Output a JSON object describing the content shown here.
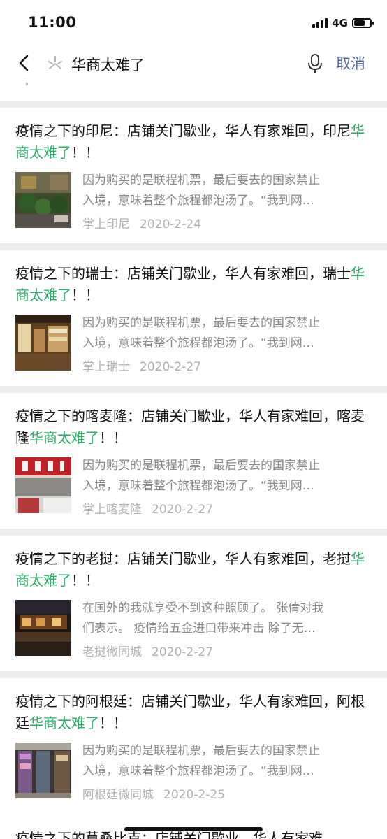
{
  "status": {
    "time": "11:00",
    "network": "4G",
    "battery_level": 0.7
  },
  "search": {
    "query": "华商太难了",
    "cancel_label": "取消"
  },
  "results": [
    {
      "title_pre": "疫情之下的印尼：店铺关门歇业，华人有家难回，印尼",
      "title_hl": "华商太难了",
      "title_post": "！！",
      "snippet_line1": "因为购买的是联程机票，最后要去的国家禁止",
      "snippet_line2": "入境，意味着整个旅程都泡汤了。“我到网…",
      "source": "掌上印尼",
      "date": "2020-2-24",
      "thumb": "street-scene"
    },
    {
      "title_pre": "疫情之下的瑞士：店铺关门歇业，华人有家难回，瑞士",
      "title_hl": "华商太难了",
      "title_post": "！！",
      "snippet_line1": "因为购买的是联程机票，最后要去的国家禁止",
      "snippet_line2": "入境，意味着整个旅程都泡汤了。“我到网…",
      "source": "掌上瑞士",
      "date": "2020-2-27",
      "thumb": "shop-interior"
    },
    {
      "title_pre": "疫情之下的喀麦隆：店铺关门歇业，华人有家难回，喀麦隆",
      "title_hl": "华商太难了",
      "title_post": "！！",
      "snippet_line1": "因为购买的是联程机票，最后要去的国家禁止",
      "snippet_line2": "入境，意味着整个旅程都泡汤了。“我到网…",
      "source": "掌上喀麦隆",
      "date": "2020-2-27",
      "thumb": "storefront-sign"
    },
    {
      "title_pre": "疫情之下的老挝：店铺关门歇业，华人有家难回，老挝",
      "title_hl": "华商太难了",
      "title_post": "！！",
      "snippet_line1": "在国外的我就享受不到这种照顾了。 张倩对我",
      "snippet_line2": "们表示。 疫情给五金进口带来冲击 除了无…",
      "source": "老挝微同城",
      "date": "2020-2-27",
      "thumb": "night-street"
    },
    {
      "title_pre": "疫情之下的阿根廷：店铺关门歇业，华人有家难回，阿根廷",
      "title_hl": "华商太难了",
      "title_post": "！！",
      "snippet_line1": "因为购买的是联程机票，最后要去的国家禁止",
      "snippet_line2": "入境，意味着整个旅程都泡汤了。“我到网…",
      "source": "阿根廷微同城",
      "date": "2020-2-25",
      "thumb": "shop-shelves"
    }
  ],
  "partial_result": {
    "title": "疫情之下的莫桑比克：店铺关门歇业，华人有家难"
  }
}
